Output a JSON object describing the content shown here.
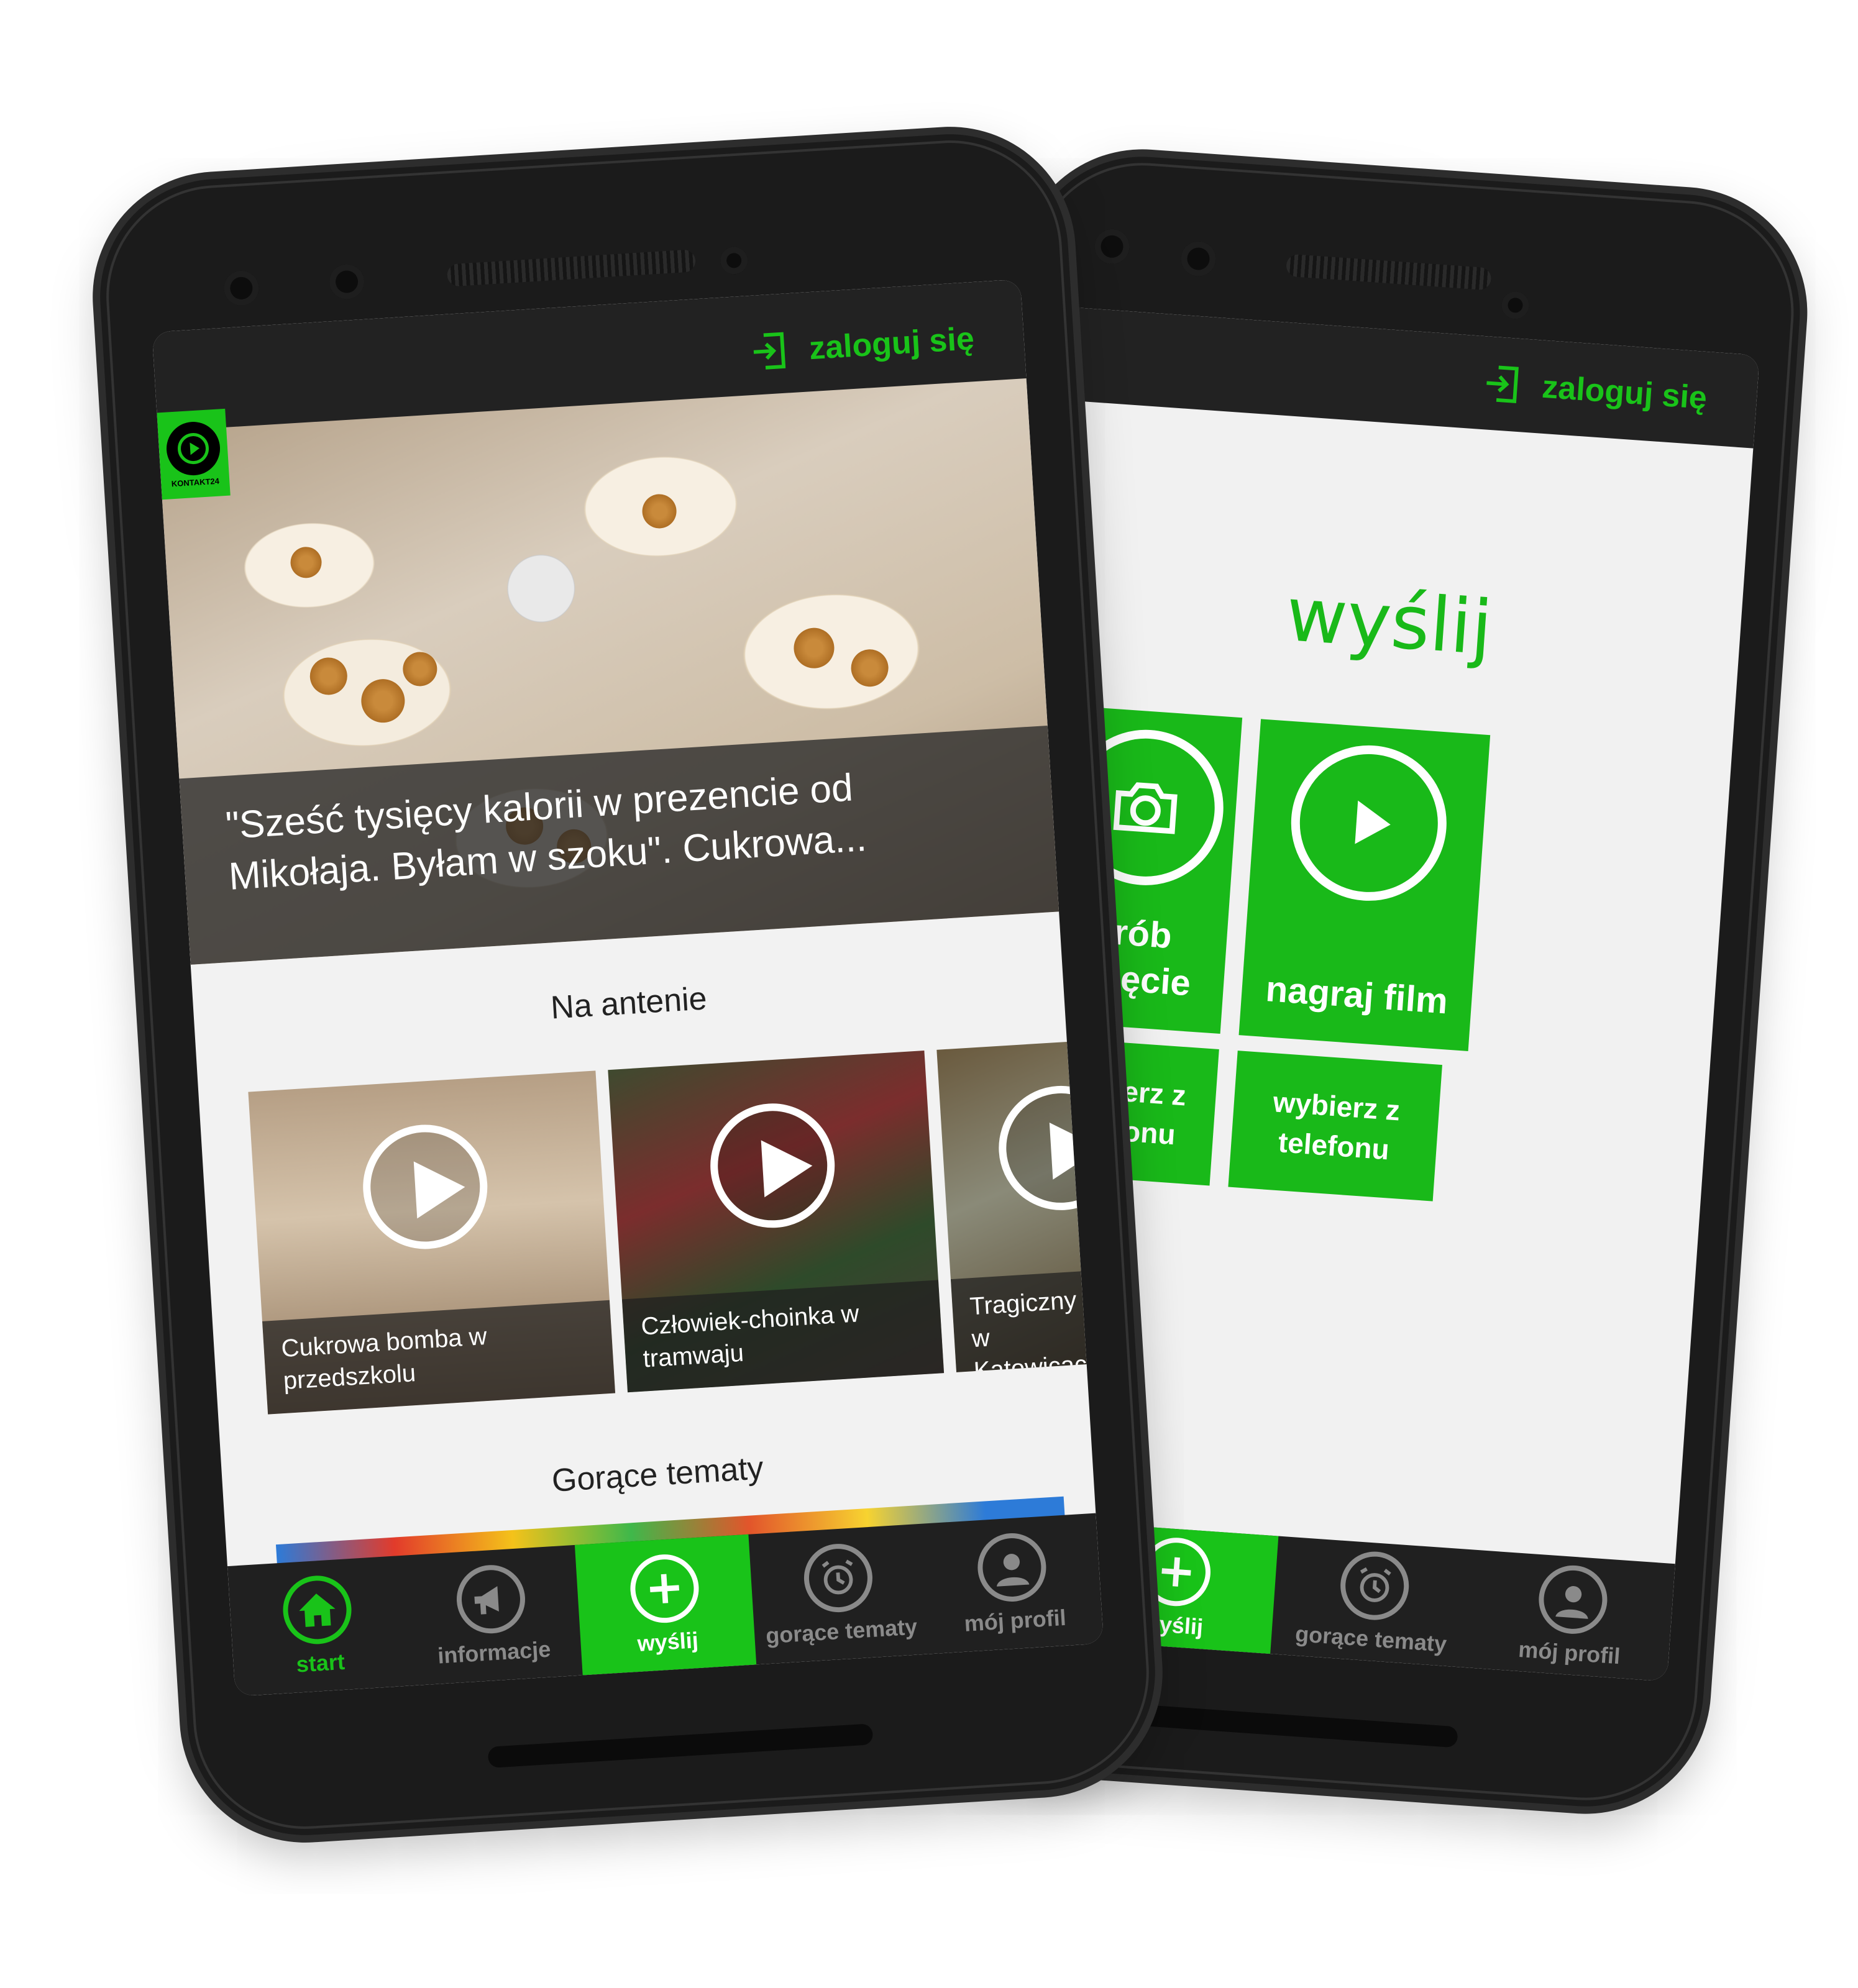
{
  "phone_left": {
    "header": {
      "login_label": "zaloguj się",
      "logo_text": "KONTAKT24"
    },
    "hero": {
      "caption": "\"Sześć tysięcy kalorii w prezencie od Mikołaja. Byłam w szoku\". Cukrowa..."
    },
    "on_air": {
      "title": "Na antenie",
      "items": [
        {
          "caption": "Cukrowa bomba w przedszkolu"
        },
        {
          "caption": "Człowiek-choinka w tramwaju"
        },
        {
          "caption": "Tragiczny w Katowicac"
        }
      ]
    },
    "hot_topics": {
      "title": "Gorące tematy"
    },
    "nav": [
      {
        "label": "start",
        "icon": "home-icon"
      },
      {
        "label": "informacje",
        "icon": "megaphone-icon"
      },
      {
        "label": "wyślij",
        "icon": "plus-icon"
      },
      {
        "label": "gorące tematy",
        "icon": "alarm-clock-icon"
      },
      {
        "label": "mój profil",
        "icon": "profile-icon"
      }
    ]
  },
  "phone_right": {
    "header": {
      "login_label": "zaloguj się"
    },
    "title": "wyślij",
    "tiles": {
      "photo": "zrób zdjęcie",
      "video": "nagraj film",
      "pick_photo": "wybierz z telefonu",
      "pick_video": "wybierz z telefonu"
    },
    "nav": [
      {
        "label": "wyślij",
        "icon": "plus-icon"
      },
      {
        "label": "gorące tematy",
        "icon": "alarm-clock-icon"
      },
      {
        "label": "mój profil",
        "icon": "profile-icon"
      }
    ]
  },
  "colors": {
    "accent": "#19c319",
    "dark": "#202020",
    "screen_bg": "#f1f1f1"
  }
}
